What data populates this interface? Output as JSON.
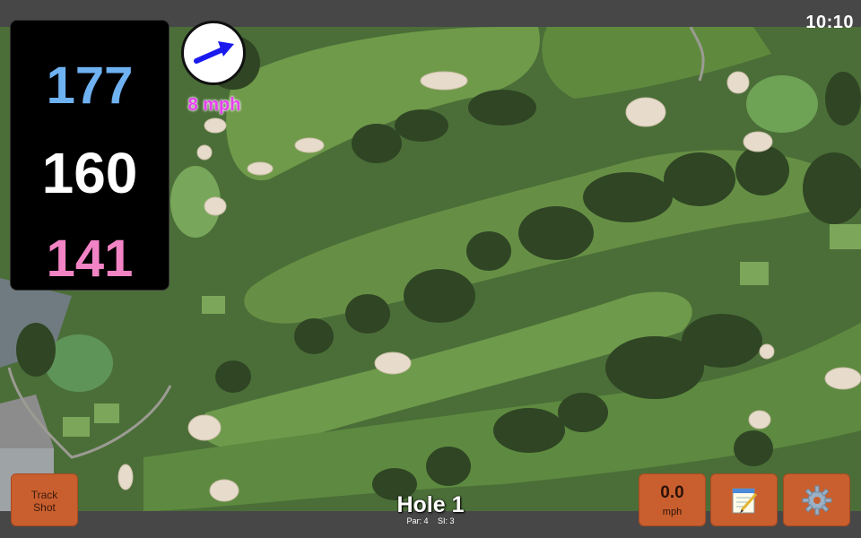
{
  "status_bar": {
    "time": "10:10"
  },
  "distances": {
    "back": "177",
    "middle": "160",
    "front": "141"
  },
  "wind": {
    "speed_label": "8 mph",
    "direction_icon": "wind-arrow"
  },
  "hole": {
    "title": "Hole 1",
    "par": "Par: 4",
    "si": "SI: 3"
  },
  "buttons": {
    "track_shot_line1": "Track",
    "track_shot_line2": "Shot",
    "speed_value": "0.0",
    "speed_unit": "mph",
    "notes_icon": "notepad-icon",
    "settings_icon": "gear-icon"
  },
  "colors": {
    "back_distance": "#6fb2f2",
    "middle_distance": "#ffffff",
    "front_distance": "#f283c4",
    "button_orange": "#c95f2e",
    "wind_text": "#e83ff0"
  }
}
